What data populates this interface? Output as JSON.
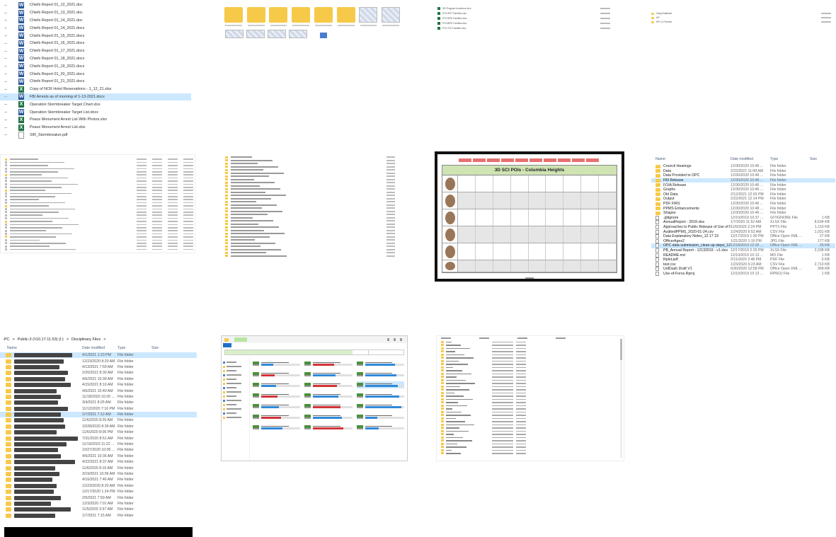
{
  "t1": {
    "files": [
      {
        "name": "Chiefs Report 01_12_2021.doc",
        "type": "word"
      },
      {
        "name": "Chiefs Report 01_13_2021.doc",
        "type": "word"
      },
      {
        "name": "Chiefs Report 01_14_2021.doc",
        "type": "word"
      },
      {
        "name": "Chiefs Report 01_14_2021.docx",
        "type": "word"
      },
      {
        "name": "Chiefs Report 01_15_2021.docx",
        "type": "word"
      },
      {
        "name": "Chiefs Report 01_16_2021.docx",
        "type": "word"
      },
      {
        "name": "Chiefs Report 01_17_2021.docx",
        "type": "word"
      },
      {
        "name": "Chiefs Report 01_18_2021.docx",
        "type": "word"
      },
      {
        "name": "Chiefs Report 01_19_2021.docx",
        "type": "word"
      },
      {
        "name": "Chiefs Report 01_20_2021.docx",
        "type": "word"
      },
      {
        "name": "Chiefs Report 01_21_2021.docx",
        "type": "word"
      },
      {
        "name": "Copy of NCR Hotel Reservations - 1_12_21.xlsx",
        "type": "excel"
      },
      {
        "name": "FBI Arrests as of morning of 1-13-2021.docx",
        "type": "word",
        "selected": true
      },
      {
        "name": "Operation Stormbreaker Target Chart.xlsx",
        "type": "excel"
      },
      {
        "name": "Operation Stormbreaker Target List.docx",
        "type": "word"
      },
      {
        "name": "Peace Monument Arrest List With Photos.xlsx",
        "type": "excel"
      },
      {
        "name": "Peace Monument Arrest List.xlsx",
        "type": "excel"
      },
      {
        "name": "SIR_Stormbreaker.pdf",
        "type": "pdf"
      }
    ]
  },
  "t8": {
    "headers": {
      "name": "Name",
      "date": "Date modified",
      "type": "Type",
      "size": "Size"
    },
    "rows": [
      {
        "name": "Council Hearings",
        "date": "12/30/2020 10:46 ...",
        "type": "File folder",
        "size": "",
        "icon": "folder"
      },
      {
        "name": "Data",
        "date": "2/22/2021 11:08 AM",
        "type": "File folder",
        "size": "",
        "icon": "folder"
      },
      {
        "name": "Data Provided to OPC",
        "date": "12/30/2020 10:46 ...",
        "type": "File folder",
        "size": "",
        "icon": "folder"
      },
      {
        "name": "FBI Release",
        "date": "12/30/2020 10:46 ...",
        "type": "File folder",
        "size": "",
        "icon": "folder",
        "selected": true
      },
      {
        "name": "FOIA Release",
        "date": "12/30/2020 10:46 ...",
        "type": "File folder",
        "size": "",
        "icon": "folder"
      },
      {
        "name": "Graphs",
        "date": "12/30/2020 10:46 ...",
        "type": "File folder",
        "size": "",
        "icon": "folder"
      },
      {
        "name": "Old Data",
        "date": "2/12/2021 12:03 PM",
        "type": "File folder",
        "size": "",
        "icon": "folder"
      },
      {
        "name": "Output",
        "date": "2/22/2021 12:14 PM",
        "type": "File folder",
        "size": "",
        "icon": "folder"
      },
      {
        "name": "PDF FIRS",
        "date": "12/30/2020 10:46 ...",
        "type": "File folder",
        "size": "",
        "icon": "folder"
      },
      {
        "name": "PPMS Enhancements",
        "date": "12/30/2020 10:48 ...",
        "type": "File folder",
        "size": "",
        "icon": "folder"
      },
      {
        "name": "Shapes",
        "date": "12/30/2020 10:46 ...",
        "type": "File folder",
        "size": "",
        "icon": "folder"
      },
      {
        "name": ".gitignore",
        "date": "12/10/2019 10:37 ...",
        "type": "GITIGNORE File",
        "size": "1 KB",
        "icon": "file"
      },
      {
        "name": "AnnualReport - 2018.xlsx",
        "date": "1/7/2020 11:52 AM",
        "type": "XLSX File",
        "size": "8,534 KB",
        "icon": "file"
      },
      {
        "name": "Approaches to Public Release of Use of F...",
        "date": "11/6/2020 2:24 PM",
        "type": "PPTX File",
        "size": "1,116 KB",
        "icon": "file"
      },
      {
        "name": "AuditedPPMS_2020-01-24.csv",
        "date": "1/24/2020 6:52 AM",
        "type": "CSV File",
        "size": "1,031 KB",
        "icon": "file"
      },
      {
        "name": "Data Explanatory Notes_12 17 19",
        "date": "12/17/2019 1:30 PM",
        "type": "Office Open XML ...",
        "size": "27 KB",
        "icon": "file"
      },
      {
        "name": "OfficerAges2",
        "date": "1/21/2020 1:16 PM",
        "type": "JPG File",
        "size": "177 KB",
        "icon": "file"
      },
      {
        "name": "OPC data submission_clean up steps_12 ...",
        "date": "12/18/2019 12:26 ...",
        "type": "Office Open XML ...",
        "size": "25 KB",
        "icon": "file",
        "selected": true
      },
      {
        "name": "PB_Annual Report - 12132019 - v1.xlsx",
        "date": "12/17/2019 2:29 PM",
        "type": "XLSX File",
        "size": "2,038 KB",
        "icon": "file"
      },
      {
        "name": "README.md",
        "date": "12/10/2019 10:13 ...",
        "type": "MD File",
        "size": "1 KB",
        "icon": "file"
      },
      {
        "name": "Rplot.pdf",
        "date": "2/11/2020 2:48 PM",
        "type": "PDF File",
        "size": "5 KB",
        "icon": "file"
      },
      {
        "name": "test.csv",
        "date": "1/23/2020 6:23 AM",
        "type": "CSV File",
        "size": "2,710 KB",
        "icon": "file"
      },
      {
        "name": "UofDash Draft V1",
        "date": "6/30/2020 12:58 PM",
        "type": "Office Open XML ...",
        "size": "368 KB",
        "icon": "file"
      },
      {
        "name": "Use-of-Force.Rproj",
        "date": "12/10/2019 10:13 ...",
        "type": "RPROJ File",
        "size": "1 KB",
        "icon": "file"
      }
    ]
  },
  "t9": {
    "breadcrumb": {
      "pc": "-PC",
      "share": "Public-3 (\\\\10.17.11.53) (I:)",
      "folder": "Disciplinary Files",
      "sep": ">"
    },
    "headers": {
      "name": "Name",
      "date": "Date modified",
      "type": "Type",
      "size": "Size"
    },
    "rows": [
      {
        "date": "4/1/2021 1:23 PM",
        "type": "File folder",
        "w": 82,
        "selected": true
      },
      {
        "date": "12/23/2020 8:20 AM",
        "type": "File folder",
        "w": 70
      },
      {
        "date": "4/13/2021 7:59 AM",
        "type": "File folder",
        "w": 64
      },
      {
        "date": "2/26/2021 8:30 AM",
        "type": "File folder",
        "w": 76
      },
      {
        "date": "4/6/2021 10:39 AM",
        "type": "File folder",
        "w": 72
      },
      {
        "date": "4/15/2021 8:10 AM",
        "type": "File folder",
        "w": 80
      },
      {
        "date": "4/6/2021 10:40 AM",
        "type": "File folder",
        "w": 60
      },
      {
        "date": "11/18/2020 10:20 ...",
        "type": "File folder",
        "w": 66
      },
      {
        "date": "3/4/2021 8:25 AM",
        "type": "File folder",
        "w": 62
      },
      {
        "date": "11/12/2020 7:16 PM",
        "type": "File folder",
        "w": 76
      },
      {
        "date": "1/7/2021 7:12 AM",
        "type": "File folder",
        "w": 66,
        "selected": true
      },
      {
        "date": "11/6/2020 8:26 AM",
        "type": "File folder",
        "w": 70
      },
      {
        "date": "10/28/2020 8:39 AM",
        "type": "File folder",
        "w": 72
      },
      {
        "date": "11/6/2020 8:06 PM",
        "type": "File folder",
        "w": 60
      },
      {
        "date": "7/31/2020 8:51 AM",
        "type": "File folder",
        "w": 90
      },
      {
        "date": "11/19/2020 11:22 ...",
        "type": "File folder",
        "w": 74
      },
      {
        "date": "10/27/2020 10:05 ...",
        "type": "File folder",
        "w": 62
      },
      {
        "date": "4/6/2021 10:36 AM",
        "type": "File folder",
        "w": 66
      },
      {
        "date": "4/22/2021 8:37 AM",
        "type": "File folder",
        "w": 86
      },
      {
        "date": "11/6/2020 8:16 AM",
        "type": "File folder",
        "w": 58
      },
      {
        "date": "3/19/2021 10:06 AM",
        "type": "File folder",
        "w": 64
      },
      {
        "date": "4/16/2021 7:46 AM",
        "type": "File folder",
        "w": 54
      },
      {
        "date": "12/23/2020 8:20 AM",
        "type": "File folder",
        "w": 60
      },
      {
        "date": "12/17/2020 1:24 PM",
        "type": "File folder",
        "w": 56
      },
      {
        "date": "2/5/2021 7:59 AM",
        "type": "File folder",
        "w": 66
      },
      {
        "date": "12/3/2020 7:01 AM",
        "type": "File folder",
        "w": 52
      },
      {
        "date": "11/5/2020 3:57 AM",
        "type": "File folder",
        "w": 80
      },
      {
        "date": "1/7/2021 7:15 AM",
        "type": "File folder",
        "w": 58
      }
    ]
  },
  "t7": {
    "header": "3D SCI POIs - Columbia Heights"
  },
  "t2": {
    "folders": 8,
    "maps": 4
  },
  "t3": {
    "files": [
      "3D Program Incidence.xlsx",
      "POI-SRT Families.xlsx",
      "POI-SRD Families.xlsx",
      "POI-BRD Families.xlsx",
      "POI-TLE Families.xlsx"
    ]
  },
  "t4": {
    "files": [
      "Gang Database",
      "HR",
      "HR Co Promise"
    ]
  },
  "colors": {
    "selection": "#cce8ff",
    "folder": "#f7c948",
    "word": "#2b579a",
    "excel": "#217346",
    "header_green": "#cfe3b3"
  }
}
